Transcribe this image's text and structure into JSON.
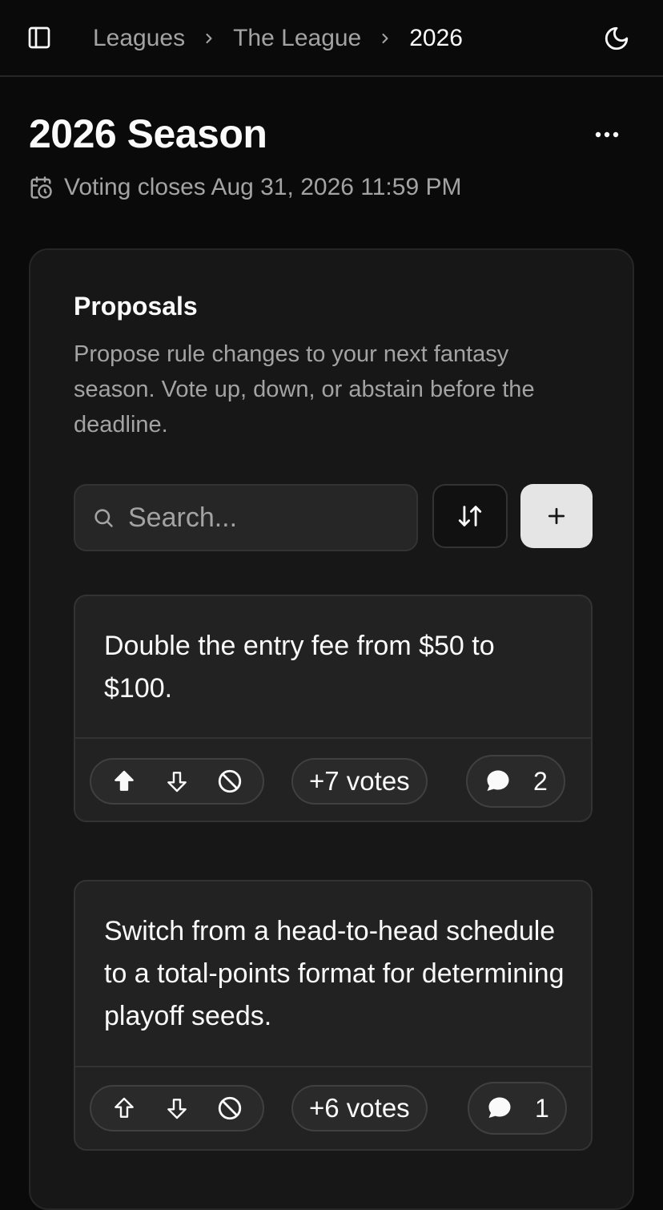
{
  "header": {
    "breadcrumbs": [
      "Leagues",
      "The League",
      "2026"
    ],
    "icons": {
      "sidebar": "sidebar-toggle-icon",
      "theme": "moon-icon"
    }
  },
  "page": {
    "title": "2026 Season",
    "deadline": "Voting closes Aug 31, 2026 11:59 PM"
  },
  "proposals_card": {
    "title": "Proposals",
    "description": "Propose rule changes to your next fantasy season. Vote up, down, or abstain before the deadline.",
    "search_placeholder": "Search..."
  },
  "proposals": [
    {
      "text": "Double the entry fee from $50 to $100.",
      "votes_label": "+7 votes",
      "comments": "2",
      "upvoted": true
    },
    {
      "text": "Switch from a head-to-head schedule to a total-points format for determining playoff seeds.",
      "votes_label": "+6 votes",
      "comments": "1",
      "upvoted": false
    }
  ],
  "colors": {
    "background": "#0a0a0a",
    "card": "#171717",
    "proposal": "#222222",
    "primary_button": "#e5e5e5"
  }
}
